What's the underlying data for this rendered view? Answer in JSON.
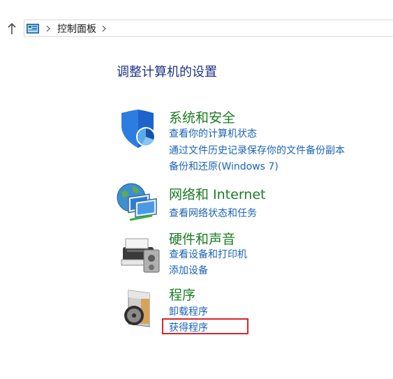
{
  "address": {
    "breadcrumb": "控制面板"
  },
  "heading": "调整计算机的设置",
  "categories": [
    {
      "icon": "security-shield-icon",
      "title": "系统和安全",
      "links": [
        "查看你的计算机状态",
        "通过文件历史记录保存你的文件备份副本",
        "备份和还原(Windows 7)"
      ]
    },
    {
      "icon": "network-globe-icon",
      "title": "网络和 Internet",
      "links": [
        "查看网络状态和任务"
      ]
    },
    {
      "icon": "printer-icon",
      "title": "硬件和声音",
      "links": [
        "查看设备和打印机",
        "添加设备"
      ]
    },
    {
      "icon": "programs-disc-icon",
      "title": "程序",
      "links": [
        "卸载程序",
        "获得程序"
      ]
    }
  ],
  "colors": {
    "heading": "#1e3287",
    "category_title": "#1b7d23",
    "link": "#1a63b8",
    "highlight": "#d9252a"
  }
}
